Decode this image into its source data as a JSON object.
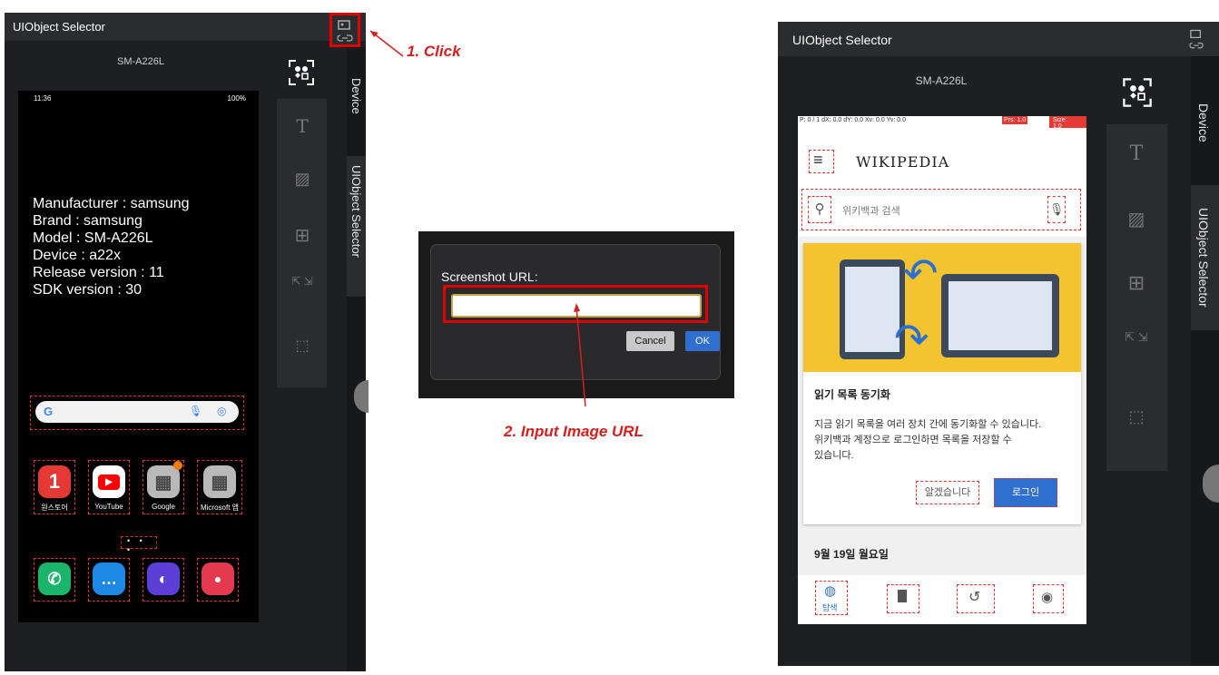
{
  "left": {
    "title": "UIObject Selector",
    "device_label": "SM-A226L",
    "status_time": "11:36",
    "status_right": "100%",
    "info_lines": [
      "Manufacturer : samsung",
      "Brand : samsung",
      "Model : SM-A226L",
      "Device : a22x",
      "Release version : 11",
      "SDK version : 30"
    ],
    "search_g": "G",
    "apps_row1": [
      {
        "label": "원스토어",
        "glyph": "1",
        "color": "#e53935"
      },
      {
        "label": "YouTube",
        "glyph": "▶",
        "color": "#ff0000"
      },
      {
        "label": "Google",
        "glyph": "▦",
        "color": "#9e9e9e"
      },
      {
        "label": "Microsoft 앱",
        "glyph": "▦",
        "color": "#9e9e9e"
      }
    ],
    "apps_row2": [
      {
        "label": "",
        "glyph": "✆",
        "color": "#1ab56b"
      },
      {
        "label": "",
        "glyph": "…",
        "color": "#1e88e5"
      },
      {
        "label": "",
        "glyph": "◐",
        "color": "#5c3dd6"
      },
      {
        "label": "",
        "glyph": "●",
        "color": "#e53950"
      }
    ],
    "side_tabs": [
      "Device",
      "UIObject Selector"
    ]
  },
  "annotations": {
    "step1": "1. Click",
    "step2": "2. Input Image URL"
  },
  "dialog": {
    "label": "Screenshot URL:",
    "input_value": "",
    "cancel": "Cancel",
    "ok": "OK"
  },
  "right": {
    "title": "UIObject Selector",
    "device_label": "SM-A226L",
    "overlay_text": "P: 0 / 1    dX: 0.0    dY: 0.0    Xv: 0.0    Yv: 0.0",
    "overlay_prs": "Prs: 1.0",
    "overlay_size": "Size: 1.0",
    "wiki_logo": "WIKIPEDIA",
    "search_placeholder": "위키백과 검색",
    "card_title": "읽기 목록 동기화",
    "card_body_1": "지금 읽기 목록을 여러 장치 간에 동기화할 수 있습니다.",
    "card_body_2": "위키백과 계정으로 로그인하면 목록을 저장할 수",
    "card_body_3": "있습니다.",
    "btn_dismiss": "알겠습니다",
    "btn_login": "로그인",
    "date_header": "9월 19일 월요일",
    "nav_explore": "탐색",
    "side_tabs": [
      "Device",
      "UIObject Selector"
    ]
  },
  "colors": {
    "accent_red": "#e00000",
    "annotation_red": "#d41f1f",
    "panel_bg": "#1e1f22",
    "dialog_bg": "#2a2a2c",
    "ok_blue": "#2f6fd0",
    "wiki_yellow": "#f4c430"
  }
}
